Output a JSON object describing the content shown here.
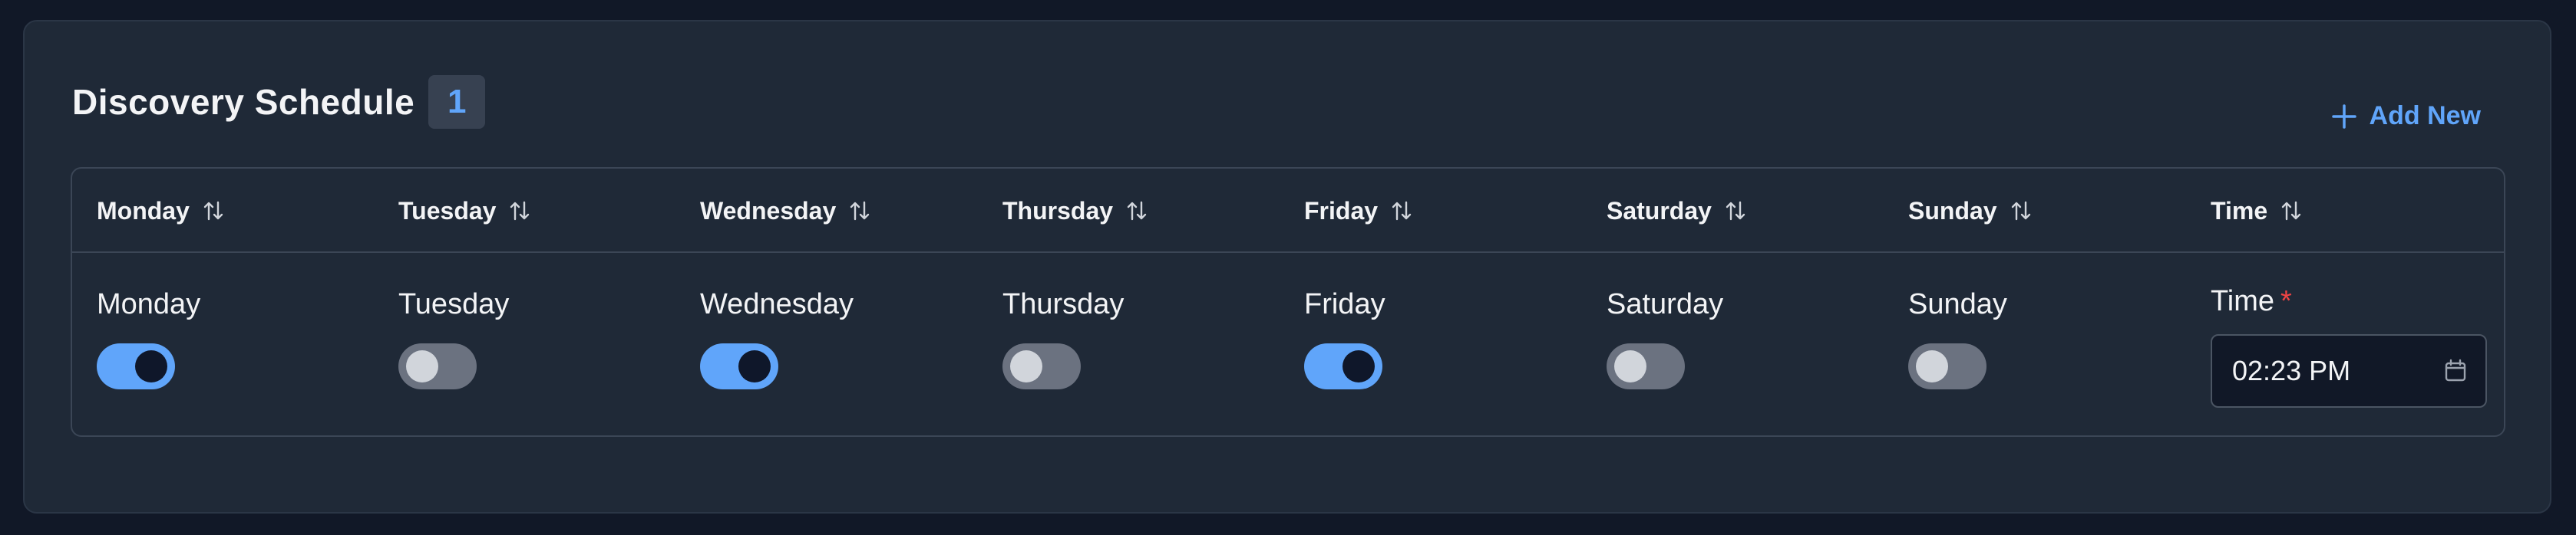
{
  "header": {
    "title": "Discovery Schedule",
    "count": "1",
    "add_new_label": "Add New"
  },
  "columns": [
    "Monday",
    "Tuesday",
    "Wednesday",
    "Thursday",
    "Friday",
    "Saturday",
    "Sunday",
    "Time"
  ],
  "row": {
    "days": [
      {
        "label": "Monday",
        "enabled": true
      },
      {
        "label": "Tuesday",
        "enabled": false
      },
      {
        "label": "Wednesday",
        "enabled": true
      },
      {
        "label": "Thursday",
        "enabled": false
      },
      {
        "label": "Friday",
        "enabled": true
      },
      {
        "label": "Saturday",
        "enabled": false
      },
      {
        "label": "Sunday",
        "enabled": false
      }
    ],
    "time_label": "Time",
    "time_required_marker": "*",
    "time_value": "02:23 PM"
  },
  "colors": {
    "accent": "#60a5fa",
    "required": "#ef4444",
    "toggle_off": "#6b7280"
  },
  "icons": {
    "add": "plus-icon",
    "sort": "sort-arrows-icon",
    "calendar": "calendar-icon"
  }
}
